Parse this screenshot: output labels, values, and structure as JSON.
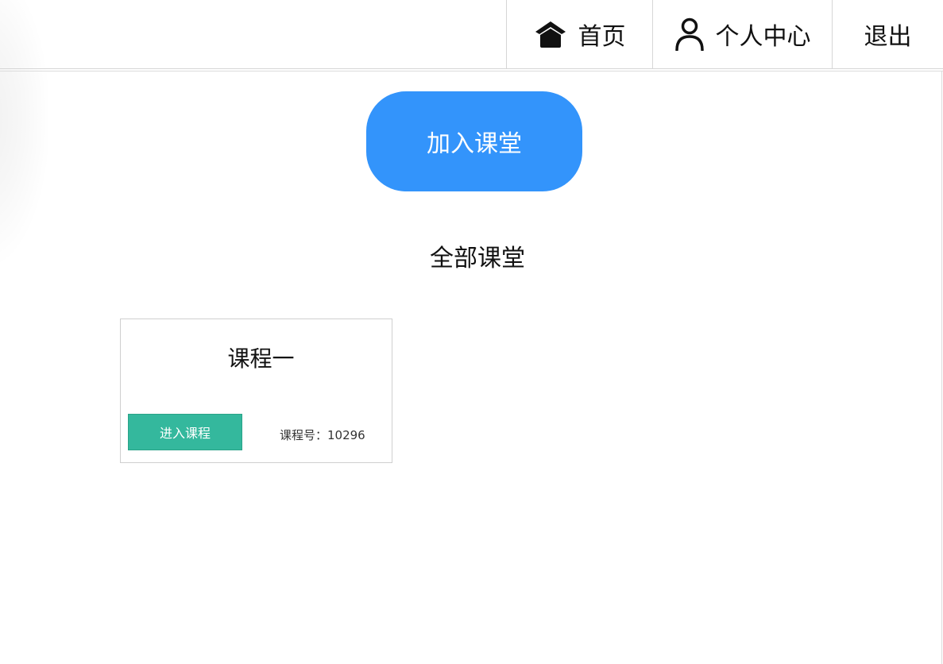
{
  "header": {
    "nav": [
      {
        "label": "首页",
        "icon": "home-icon"
      },
      {
        "label": "个人中心",
        "icon": "user-icon"
      },
      {
        "label": "退出"
      }
    ]
  },
  "main": {
    "join_button_label": "加入课堂",
    "section_title": "全部课堂",
    "courses": [
      {
        "name": "课程一",
        "enter_label": "进入课程",
        "code_text": "课程号：10296"
      }
    ]
  },
  "colors": {
    "primary": "#3394fb",
    "enter_button": "#34b89d",
    "border": "#d6d6d6"
  }
}
